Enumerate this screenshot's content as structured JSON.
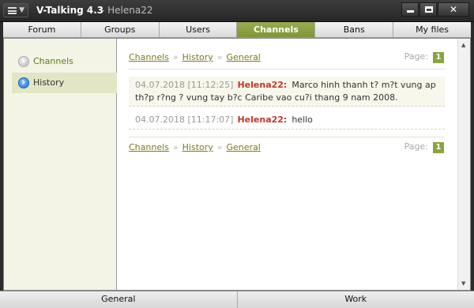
{
  "window": {
    "app_title": "V-Talking 4.3",
    "subtitle": "- Helena22"
  },
  "tabs": [
    {
      "label": "Forum",
      "active": false
    },
    {
      "label": "Groups",
      "active": false
    },
    {
      "label": "Users",
      "active": false
    },
    {
      "label": "Channels",
      "active": true
    },
    {
      "label": "Bans",
      "active": false
    },
    {
      "label": "My files",
      "active": false
    }
  ],
  "sidebar": {
    "items": [
      {
        "label": "Channels",
        "icon": "arrow-circle-grey-icon"
      },
      {
        "label": "History",
        "icon": "arrow-circle-blue-icon",
        "selected": true
      }
    ]
  },
  "breadcrumb": {
    "items": [
      "Channels",
      "History",
      "General"
    ],
    "separator": "»"
  },
  "pager": {
    "label": "Page:",
    "current": "1"
  },
  "messages": [
    {
      "time": "04.07.2018 [11:12:25]",
      "author": "Helena22:",
      "text": "Marco hinh thanh t? m?t vung ap th?p r?ng ? vung tay b?c Caribe vao cu?i thang 9 nam 2008."
    },
    {
      "time": "04.07.2018 [11:17:07]",
      "author": "Helena22:",
      "text": "hello"
    }
  ],
  "bottom_tabs": [
    "General",
    "Work"
  ],
  "colors": {
    "accent": "#8aa33c",
    "author": "#c0392b",
    "link": "#7c7a1a"
  }
}
